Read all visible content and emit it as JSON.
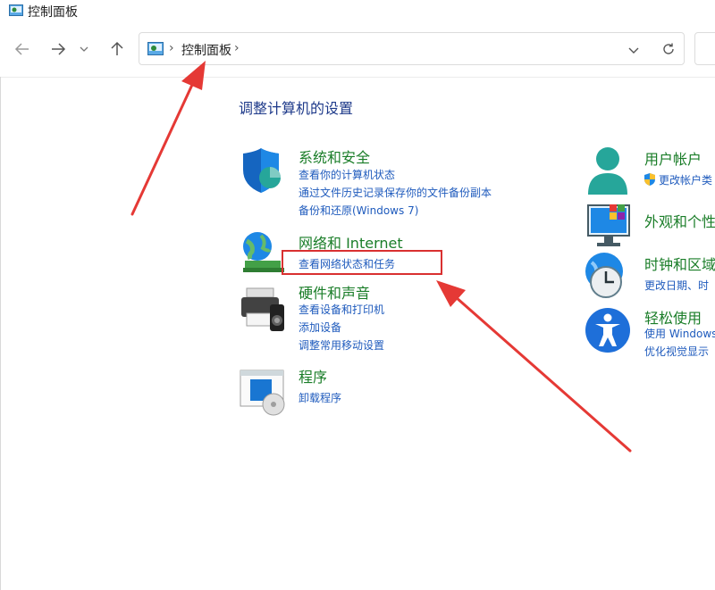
{
  "window": {
    "title": "控制面板",
    "app_icon": "control-panel-icon"
  },
  "navigation": {
    "back_icon": "back-arrow-icon",
    "forward_icon": "forward-arrow-icon",
    "recent_icon": "chevron-down-icon",
    "up_icon": "up-arrow-icon",
    "breadcrumb": [
      "控制面板"
    ],
    "dropdown_icon": "chevron-down-icon",
    "refresh_icon": "refresh-icon"
  },
  "main": {
    "heading": "调整计算机的设置",
    "left_categories": [
      {
        "title": "系统和安全",
        "icon": "shield-icon",
        "links": [
          "查看你的计算机状态",
          "通过文件历史记录保存你的文件备份副本",
          "备份和还原(Windows 7)"
        ]
      },
      {
        "title": "网络和 Internet",
        "icon": "network-globe-icon",
        "links": [
          "查看网络状态和任务"
        ]
      },
      {
        "title": "硬件和声音",
        "icon": "printer-icon",
        "links": [
          "查看设备和打印机",
          "添加设备",
          "调整常用移动设置"
        ]
      },
      {
        "title": "程序",
        "icon": "programs-icon",
        "links": [
          "卸载程序"
        ]
      }
    ],
    "right_categories": [
      {
        "title": "用户帐户",
        "icon": "user-icon",
        "links": [
          "更改帐户类"
        ]
      },
      {
        "title": "外观和个性",
        "icon": "monitor-tiles-icon",
        "links": []
      },
      {
        "title": "时钟和区域",
        "icon": "clock-globe-icon",
        "links": [
          "更改日期、时"
        ]
      },
      {
        "title": "轻松使用",
        "icon": "accessibility-icon",
        "links": [
          "使用 Windows",
          "优化视觉显示"
        ]
      }
    ]
  },
  "colors": {
    "category_title": "#1a7d28",
    "link": "#1f5bbd",
    "heading": "#1e3a8a",
    "annotation": "#d93030"
  }
}
